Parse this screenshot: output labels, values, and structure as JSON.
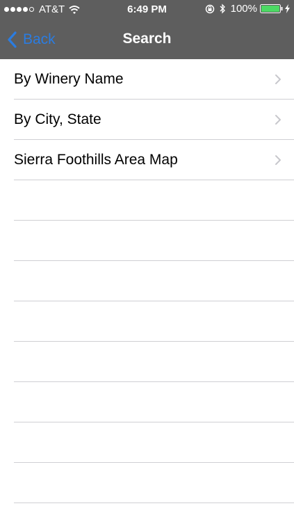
{
  "status_bar": {
    "carrier": "AT&T",
    "time": "6:49 PM",
    "battery_percent": "100%",
    "battery_color": "#4cd964"
  },
  "nav": {
    "back_label": "Back",
    "title": "Search",
    "background": "#5e5e5e",
    "back_color": "#2b7ce0"
  },
  "menu": {
    "items": [
      {
        "label": "By Winery Name"
      },
      {
        "label": "By City, State"
      },
      {
        "label": "Sierra Foothills Area Map"
      }
    ]
  },
  "icons": {
    "back": "chevron-left-icon",
    "disclosure": "chevron-right-icon",
    "wifi": "wifi-icon",
    "bluetooth": "bluetooth-icon",
    "rotation_lock": "rotation-lock-icon",
    "battery": "battery-icon",
    "charging": "charging-bolt-icon"
  }
}
